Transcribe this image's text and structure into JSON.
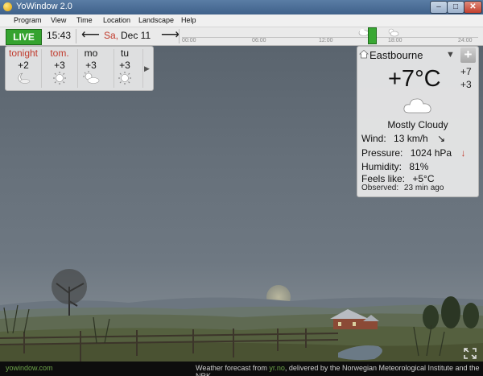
{
  "window": {
    "title": "YoWindow 2.0"
  },
  "menu": [
    "Program",
    "View",
    "Time",
    "Location",
    "Landscape",
    "Help"
  ],
  "toolbar": {
    "live": "LIVE",
    "time": "15:43",
    "day": "Sa,",
    "date": "Dec 11",
    "ticks": [
      "00:00",
      "06:00",
      "12:00",
      "18:00",
      "24:00"
    ]
  },
  "forecast": [
    {
      "label": "tonight",
      "temp": "+2",
      "icon": "moon-cloud-icon",
      "highlight": true
    },
    {
      "label": "tom.",
      "temp": "+3",
      "icon": "sun-icon",
      "highlight": true
    },
    {
      "label": "mo",
      "temp": "+3",
      "icon": "sun-cloud-icon",
      "highlight": false
    },
    {
      "label": "tu",
      "temp": "+3",
      "icon": "sun-icon",
      "highlight": false
    }
  ],
  "current": {
    "location": "Eastbourne",
    "temp": "+7°C",
    "hi": "+7",
    "lo": "+3",
    "condition": "Mostly Cloudy",
    "wind_label": "Wind:",
    "wind_value": "13 km/h",
    "pressure_label": "Pressure:",
    "pressure_value": "1024 hPa",
    "humidity_label": "Humidity:",
    "humidity_value": "81%",
    "feels_label": "Feels like:",
    "feels_value": "+5°C",
    "observed": "Observed:",
    "observed_value": "23 min ago"
  },
  "status": {
    "brand": "yowindow.com",
    "credit_pre": "Weather forecast from",
    "credit_link": "yr.no",
    "credit_post": ", delivered by the Norwegian Meteorological Institute and the NRK"
  },
  "colors": {
    "live": "#35a32f",
    "accent_red": "#c0392b",
    "link_green": "#6fa64a"
  }
}
